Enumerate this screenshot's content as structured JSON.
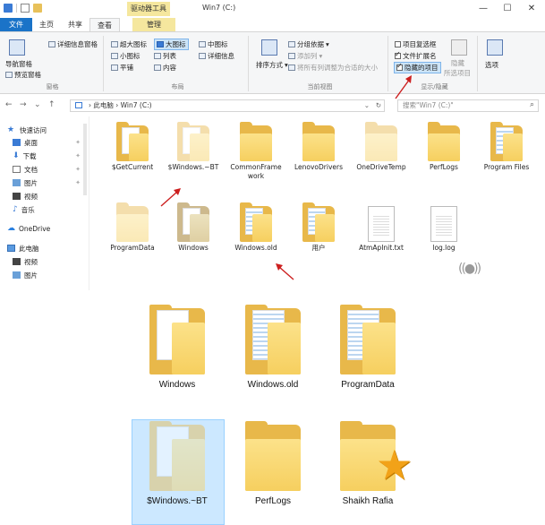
{
  "titlebar": {
    "drive_tools_tab": "驱动器工具",
    "title": "Win7 (C:)",
    "minimize": "—",
    "maximize": "☐",
    "close": "✕"
  },
  "tabs": {
    "file": "文件",
    "home": "主页",
    "share": "共享",
    "view": "查看",
    "manage": "管理"
  },
  "ribbon": {
    "panes": {
      "nav_pane": "导航窗格",
      "preview_pane": "预览窗格",
      "details_pane": "详细信息窗格",
      "label": "窗格"
    },
    "layout": {
      "extra_large": "超大图标",
      "large": "大图标",
      "medium": "中图标",
      "small": "小图标",
      "list": "列表",
      "details": "详细信息",
      "tiles": "平铺",
      "content": "内容",
      "label": "布局"
    },
    "current_view": {
      "sort_by": "排序方式",
      "group_by": "分组依据",
      "add_columns": "添加列",
      "size_columns": "将所有列调整为合适的大小",
      "label": "当前视图"
    },
    "show_hide": {
      "item_checkboxes": "项目复选框",
      "file_extensions": "文件扩展名",
      "hidden_items": "隐藏的项目",
      "hide": "隐藏",
      "hide_selected": "所选项目",
      "label": "显示/隐藏"
    },
    "options": "选项"
  },
  "address": {
    "breadcrumb_pc": "此电脑",
    "breadcrumb_drive": "Win7 (C:)",
    "search_placeholder": "搜索\"Win7 (C:)\""
  },
  "navpane": {
    "quick_access": "快速访问",
    "desktop": "桌面",
    "downloads": "下载",
    "documents": "文档",
    "pictures": "图片",
    "videos": "视频",
    "music": "音乐",
    "onedrive": "OneDrive",
    "this_pc": "此电脑",
    "pc_videos": "视频",
    "pc_pictures": "图片"
  },
  "files": [
    {
      "name": "$GetCurrent"
    },
    {
      "name": "$Windows.~BT"
    },
    {
      "name": "CommonFrame work"
    },
    {
      "name": "LenovoDrivers"
    },
    {
      "name": "OneDriveTemp"
    },
    {
      "name": "PerfLogs"
    },
    {
      "name": "Program Files"
    },
    {
      "name": "ProgramData"
    },
    {
      "name": "Windows"
    },
    {
      "name": "Windows.old"
    },
    {
      "name": "用户"
    },
    {
      "name": "AtmApInit.txt"
    },
    {
      "name": "log.log"
    }
  ],
  "big_folders": [
    {
      "name": "Windows"
    },
    {
      "name": "Windows.old"
    },
    {
      "name": "ProgramData"
    },
    {
      "name": "$Windows.~BT"
    },
    {
      "name": "PerfLogs"
    },
    {
      "name": "Shaikh Rafia"
    }
  ],
  "colors": {
    "accent": "#1a73c8",
    "folder": "#f6cf5f",
    "arrow": "#cc1f1f",
    "selection": "#cce8ff"
  }
}
